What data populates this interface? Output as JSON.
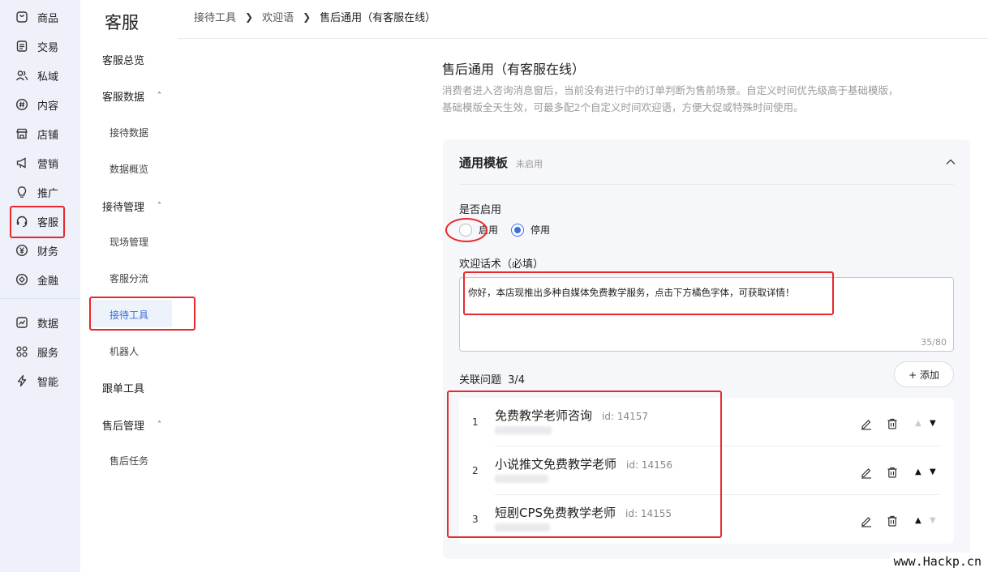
{
  "rail": {
    "items": [
      {
        "label": "商品",
        "icon": "bag-icon"
      },
      {
        "label": "交易",
        "icon": "document-icon"
      },
      {
        "label": "私域",
        "icon": "users-icon"
      },
      {
        "label": "内容",
        "icon": "hash-icon"
      },
      {
        "label": "店铺",
        "icon": "store-icon"
      },
      {
        "label": "营销",
        "icon": "megaphone-icon"
      },
      {
        "label": "推广",
        "icon": "bulb-icon"
      },
      {
        "label": "客服",
        "icon": "headset-icon"
      },
      {
        "label": "财务",
        "icon": "yuan-icon"
      },
      {
        "label": "金融",
        "icon": "diamond-icon"
      },
      {
        "label": "数据",
        "icon": "chart-icon"
      },
      {
        "label": "服务",
        "icon": "grid-icon"
      },
      {
        "label": "智能",
        "icon": "bolt-icon"
      }
    ]
  },
  "subnav": {
    "title": "客服",
    "overview": "客服总览",
    "data_group": "客服数据",
    "reception_data": "接待数据",
    "data_overview": "数据概览",
    "mgmt_group": "接待管理",
    "site_mgmt": "现场管理",
    "diversion": "客服分流",
    "tools": "接待工具",
    "robot": "机器人",
    "order_tools": "跟单工具",
    "aftersale_group": "售后管理",
    "aftersale_task": "售后任务"
  },
  "breadcrumb": {
    "l1": "接待工具",
    "l2": "欢迎语",
    "l3": "售后通用（有客服在线）"
  },
  "page": {
    "title": "售后通用（有客服在线）",
    "desc_line1": "消费者进入咨询消息窗后，当前没有进行中的订单判断为售前场景。自定义时间优先级高于基础模版，",
    "desc_line2": "基础模版全天生效，可最多配2个自定义时间欢迎语，方便大促或特殊时间使用。"
  },
  "card": {
    "title": "通用模板",
    "status": "未启用",
    "enable_label": "是否启用",
    "option_on": "启用",
    "option_off": "停用",
    "selected": "停用",
    "welcome_label": "欢迎话术（必填）",
    "welcome_text": "你好，本店现推出多种自媒体免费教学服务，点击下方橘色字体，可获取详情！",
    "welcome_count": "35/80",
    "related_label": "关联问题",
    "related_count": "3/4",
    "add_label": "+ 添加"
  },
  "questions": [
    {
      "num": "1",
      "title": "免费教学老师咨询",
      "id": "id: 14157",
      "up_enabled": false,
      "down_enabled": true
    },
    {
      "num": "2",
      "title": "小说推文免费教学老师",
      "id": "id: 14156",
      "up_enabled": true,
      "down_enabled": true
    },
    {
      "num": "3",
      "title": "短剧CPS免费教学老师",
      "id": "id: 14155",
      "up_enabled": true,
      "down_enabled": false
    }
  ],
  "colors": {
    "accent": "#3b6fe0",
    "annotation": "#e8282b",
    "rail_bg": "#eef1f9"
  },
  "watermark": "www.Hackp.cn"
}
